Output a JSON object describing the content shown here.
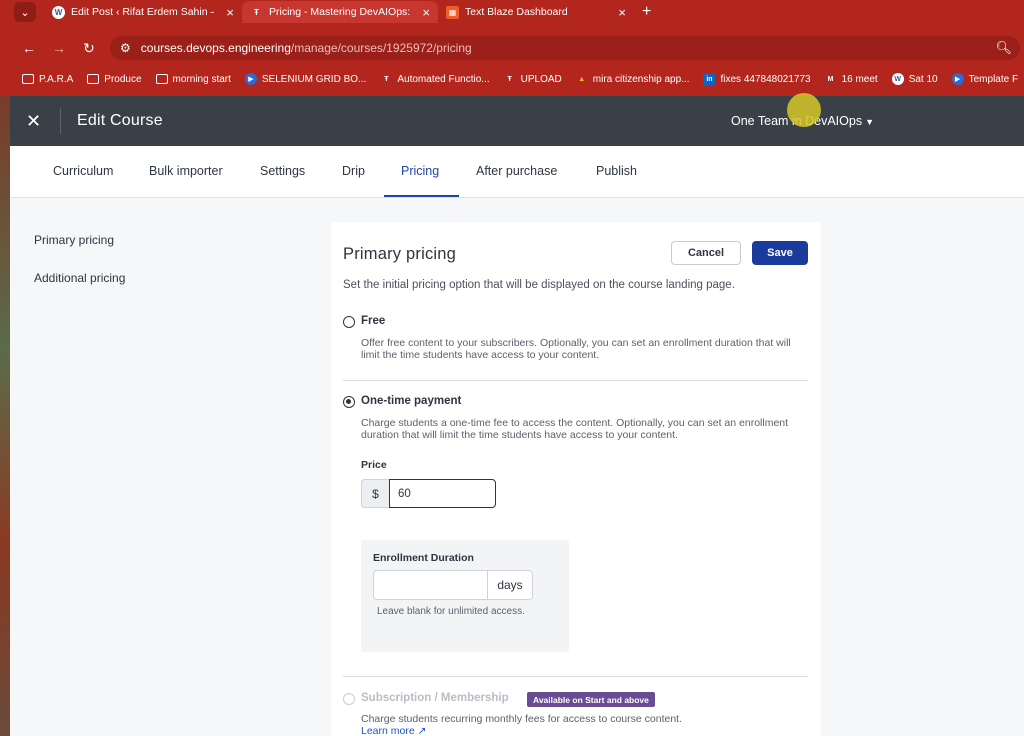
{
  "browser": {
    "tabs": [
      {
        "title": "Edit Post ‹ Rifat Erdem Sahin —",
        "favicon": "wordpress-icon",
        "active": false
      },
      {
        "title": "Pricing - Mastering DevAIOps: T",
        "favicon": "teachable-icon",
        "active": true
      },
      {
        "title": "Text Blaze Dashboard",
        "favicon": "text-blaze-icon",
        "active": false
      }
    ],
    "url_domain": "courses.devops.engineering",
    "url_path": "/manage/courses/1925972/pricing",
    "bookmarks": [
      "P.A.R.A",
      "Produce",
      "morning start",
      "SELENIUM GRID BO...",
      "Automated Functio...",
      "UPLOAD",
      "mira citizenship app...",
      "fixes 447848021773",
      "16 meet",
      "Sat 10",
      "Template F"
    ],
    "colors": {
      "chrome": "#b3261e",
      "active_tab": "#c8372f"
    }
  },
  "header": {
    "title": "Edit Course",
    "team": "One Team in DevAIOps"
  },
  "tabs": [
    "Curriculum",
    "Bulk importer",
    "Settings",
    "Drip",
    "Pricing",
    "After purchase",
    "Publish"
  ],
  "active_tab": "Pricing",
  "sidebar": {
    "items": [
      "Primary pricing",
      "Additional pricing"
    ]
  },
  "card": {
    "title": "Primary pricing",
    "cancel_label": "Cancel",
    "save_label": "Save",
    "subtitle": "Set the initial pricing option that will be displayed on the course landing page.",
    "options": [
      {
        "label": "Free",
        "desc": "Offer free content to your subscribers. Optionally, you can set an enrollment duration that will limit the time students have access to your content.",
        "checked": false
      },
      {
        "label": "One-time payment",
        "desc": "Charge students a one-time fee to access the content. Optionally, you can set an enrollment duration that will limit the time students have access to your content.",
        "checked": true
      },
      {
        "label": "Subscription / Membership",
        "desc": "Charge students recurring monthly fees for access to course content.",
        "checked": false,
        "disabled": true
      }
    ],
    "price_label": "Price",
    "currency": "$",
    "price_value": "60",
    "enrollment_label": "Enrollment Duration",
    "enrollment_value": "",
    "enrollment_unit": "days",
    "enrollment_help": "Leave blank for unlimited access.",
    "badge": "Available on Start and above",
    "learn_more": "Learn more ↗"
  },
  "colors": {
    "primary": "#1a3b9c",
    "header_bg": "#3a4048",
    "badge": "#6a4c93"
  }
}
